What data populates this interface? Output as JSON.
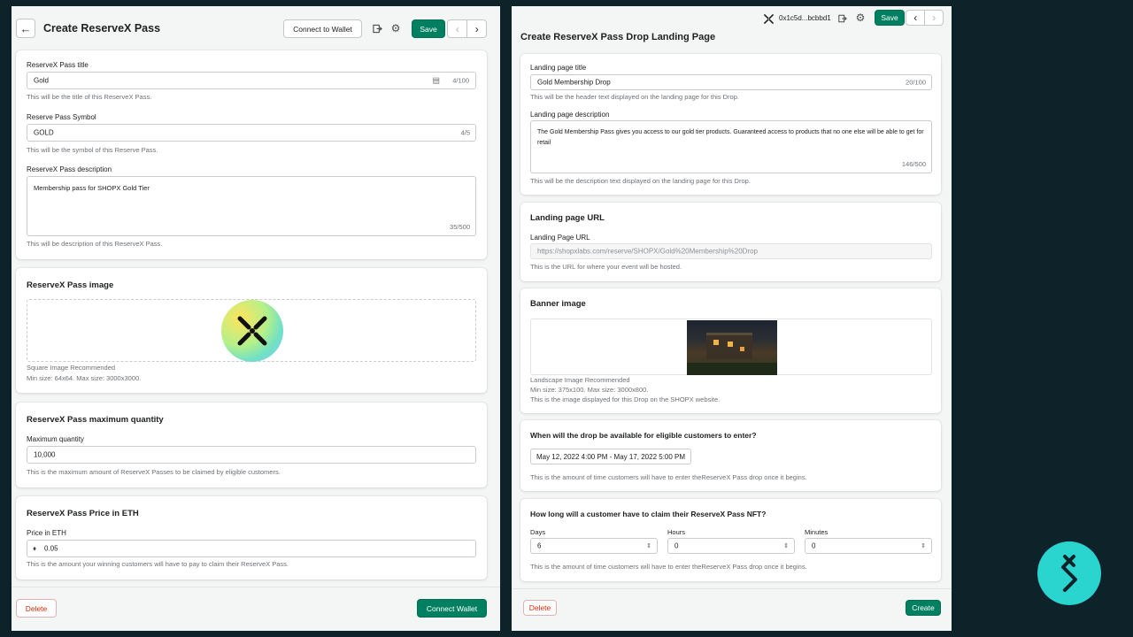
{
  "left": {
    "title": "Create ReserveX Pass",
    "connect_label": "Connect to Wallet",
    "save_label": "Save",
    "info_card": {
      "title_label": "ReserveX Pass title",
      "title_value": "Gold",
      "title_count": "4/100",
      "title_help": "This will be the title of this ReserveX Pass.",
      "symbol_label": "Reserve Pass Symbol",
      "symbol_value": "GOLD",
      "symbol_count": "4/5",
      "symbol_help": "This will be the symbol of this Reserve Pass.",
      "desc_label": "ReserveX Pass description",
      "desc_value": "Membership pass for SHOPX Gold Tier",
      "desc_count": "35/500",
      "desc_help": "This will be description of this ReserveX Pass."
    },
    "image_card": {
      "heading": "ReserveX Pass image",
      "help1": "Square Image Recommended",
      "help2": "Min size: 64x64. Max size: 3000x3000."
    },
    "quantity_card": {
      "heading": "ReserveX Pass maximum quantity",
      "label": "Maximum quantity",
      "value": "10,000",
      "help": "This is the maximum amount of ReserveX Passes to be claimed by eligible customers."
    },
    "price_card": {
      "heading": "ReserveX Pass Price in ETH",
      "label": "Price in ETH",
      "value": "0.05",
      "help": "This is the amount your winning customers will have to pay to claim their ReserveX Pass."
    },
    "delete_label": "Delete",
    "footer_primary": "Connect Wallet"
  },
  "right": {
    "wallet_address": "0x1c5d...bcbbd1",
    "save_label": "Save",
    "title": "Create ReserveX Pass Drop Landing Page",
    "landing_card": {
      "title_label": "Landing page title",
      "title_value": "Gold Membership Drop",
      "title_count": "20/100",
      "title_help": "This will be the header text displayed on the landing page for this Drop.",
      "desc_label": "Landing page description",
      "desc_value": "The Gold Membership Pass gives you access to our gold tier products. Guaranteed access to products that no one else will be able to get for retail",
      "desc_count": "146/500",
      "desc_help": "This will be the description text displayed on the landing page for this Drop."
    },
    "url_card": {
      "heading": "Landing page URL",
      "label": "Landing Page URL",
      "value": "https://shopxlabs.com/reserve/SHOPX/Gold%20Membership%20Drop",
      "help": "This is the URL for where your event will be hosted."
    },
    "banner_card": {
      "heading": "Banner image",
      "help1": "Landscape Image Recommended",
      "help2": "Min size: 375x100. Max size: 3000x800.",
      "help3": "This is the image displayed for this Drop on the SHOPX website."
    },
    "availability_card": {
      "heading": "When will the drop be available for eligible customers to enter?",
      "date_range": "May 12, 2022 4:00 PM - May 17, 2022 5:00 PM",
      "help": "This is the amount of time customers will have to enter theReserveX Pass drop once it begins."
    },
    "claim_card": {
      "heading": "How long will a customer have to claim their ReserveX Pass NFT?",
      "days_label": "Days",
      "days_value": "6",
      "hours_label": "Hours",
      "hours_value": "0",
      "minutes_label": "Minutes",
      "minutes_value": "0",
      "help": "This is the amount of time customers will have to enter theReserveX Pass drop once it begins."
    },
    "delete_label": "Delete",
    "create_label": "Create"
  },
  "colors": {
    "background": "#0d2229",
    "primary": "#008060",
    "danger": "#d72c0d",
    "brand_circle": "#2ad4cf"
  },
  "icons": {
    "back": "arrow-left-icon",
    "exit": "exit-icon",
    "settings": "gear-icon",
    "prev": "chevron-left-icon",
    "next": "chevron-right-icon",
    "ethereum": "ethereum-icon",
    "brand": "shopx-logo-icon"
  }
}
